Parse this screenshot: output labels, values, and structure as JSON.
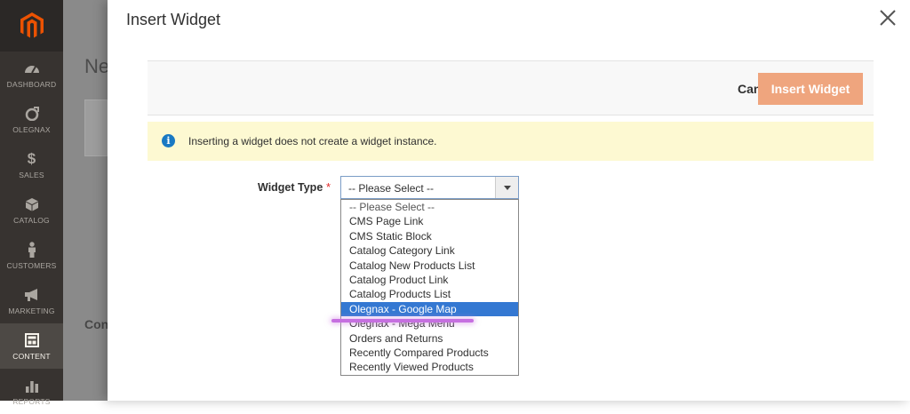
{
  "sidebar": {
    "items": [
      {
        "label": "DASHBOARD",
        "icon": "dashboard-icon"
      },
      {
        "label": "OLEGNAX",
        "icon": "olegnax-icon"
      },
      {
        "label": "SALES",
        "icon": "dollar-icon"
      },
      {
        "label": "CATALOG",
        "icon": "cube-icon"
      },
      {
        "label": "CUSTOMERS",
        "icon": "person-icon"
      },
      {
        "label": "MARKETING",
        "icon": "megaphone-icon"
      },
      {
        "label": "CONTENT",
        "icon": "content-icon",
        "active": true
      },
      {
        "label": "REPORTS",
        "icon": "bar-chart-icon"
      }
    ]
  },
  "background": {
    "title": "Ne",
    "subtitle": "Con"
  },
  "modal": {
    "title": "Insert Widget",
    "cancel_label": "Cancel",
    "insert_label": "Insert Widget",
    "notice_text": "Inserting a widget does not create a widget instance.",
    "field_label": "Widget Type",
    "required_mark": "*",
    "select_value": "-- Please Select --",
    "options": [
      "-- Please Select --",
      "CMS Page Link",
      "CMS Static Block",
      "Catalog Category Link",
      "Catalog New Products List",
      "Catalog Product Link",
      "Catalog Products List",
      "Olegnax - Google Map",
      "Olegnax - Mega Menu",
      "Orders and Returns",
      "Recently Compared Products",
      "Recently Viewed Products"
    ],
    "selected_option": "Olegnax - Google Map"
  },
  "colors": {
    "accent": "#efa57e",
    "sidebar": "#373330",
    "logo": "#eb5202",
    "selected": "#3478d2",
    "notice": "#fdf9d2",
    "highlight": "#c66fe0"
  }
}
